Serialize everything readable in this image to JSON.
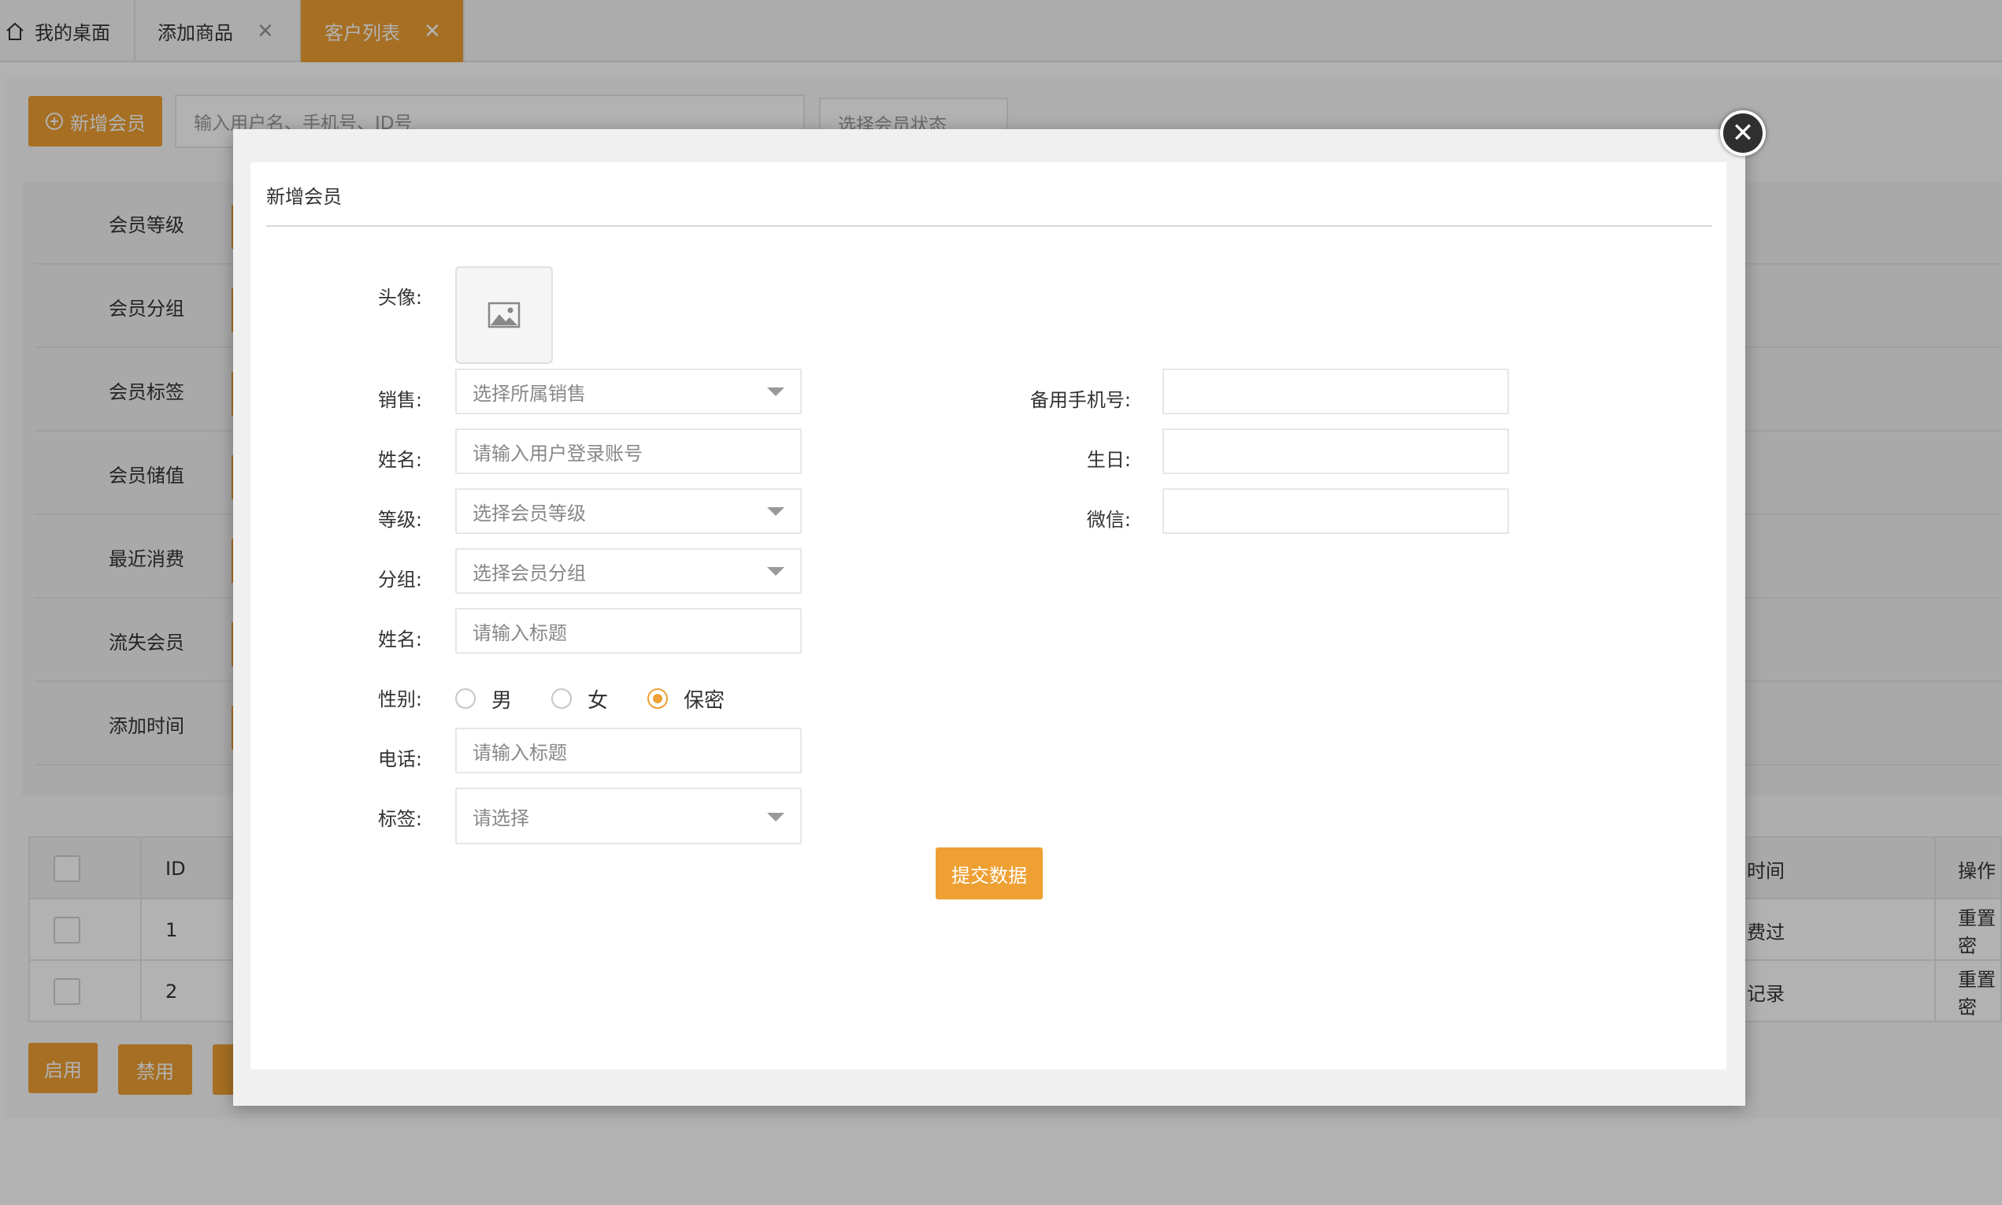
{
  "tabs": [
    {
      "label": "我的桌面",
      "closable": false,
      "active": false
    },
    {
      "label": "添加商品",
      "closable": true,
      "active": false
    },
    {
      "label": "客户列表",
      "closable": true,
      "active": true
    }
  ],
  "tab_close_glyph": "✕",
  "toolbar": {
    "add_member_label": "新增会员",
    "search_placeholder": "输入用户名、手机号、ID号",
    "status_select": "选择会员状态"
  },
  "filters": [
    "会员等级",
    "会员分组",
    "会员标签",
    "会员储值",
    "最近消费",
    "流失会员",
    "添加时间"
  ],
  "table": {
    "headers": {
      "id": "ID",
      "time": "时间",
      "actions": "操作"
    },
    "rows": [
      {
        "id": "1",
        "time_text": "费过",
        "action": "重置密"
      },
      {
        "id": "2",
        "time_text": "记录",
        "action": "重置密"
      }
    ]
  },
  "bulk_actions": {
    "enable": "启用",
    "disable": "禁用"
  },
  "modal": {
    "title": "新增会员",
    "close_glyph": "✕",
    "labels": {
      "avatar": "头像:",
      "sales": "销售:",
      "name1": "姓名:",
      "level": "等级:",
      "group": "分组:",
      "name2": "姓名:",
      "gender": "性别:",
      "phone": "电话:",
      "tags": "标签:",
      "backup_phone": "备用手机号:",
      "birthday": "生日:",
      "wechat": "微信:"
    },
    "fields": {
      "sales_select": "选择所属销售",
      "name1_placeholder": "请输入用户登录账号",
      "level_select": "选择会员等级",
      "group_select": "选择会员分组",
      "name2_placeholder": "请输入标题",
      "phone_placeholder": "请输入标题",
      "tags_select": "请选择",
      "backup_phone_value": "",
      "birthday_value": "",
      "wechat_value": ""
    },
    "gender_options": [
      {
        "label": "男",
        "checked": false
      },
      {
        "label": "女",
        "checked": false
      },
      {
        "label": "保密",
        "checked": true
      }
    ],
    "submit_label": "提交数据"
  },
  "colors": {
    "accent": "#eea033",
    "overlay": "rgba(0,0,0,0.3)"
  }
}
